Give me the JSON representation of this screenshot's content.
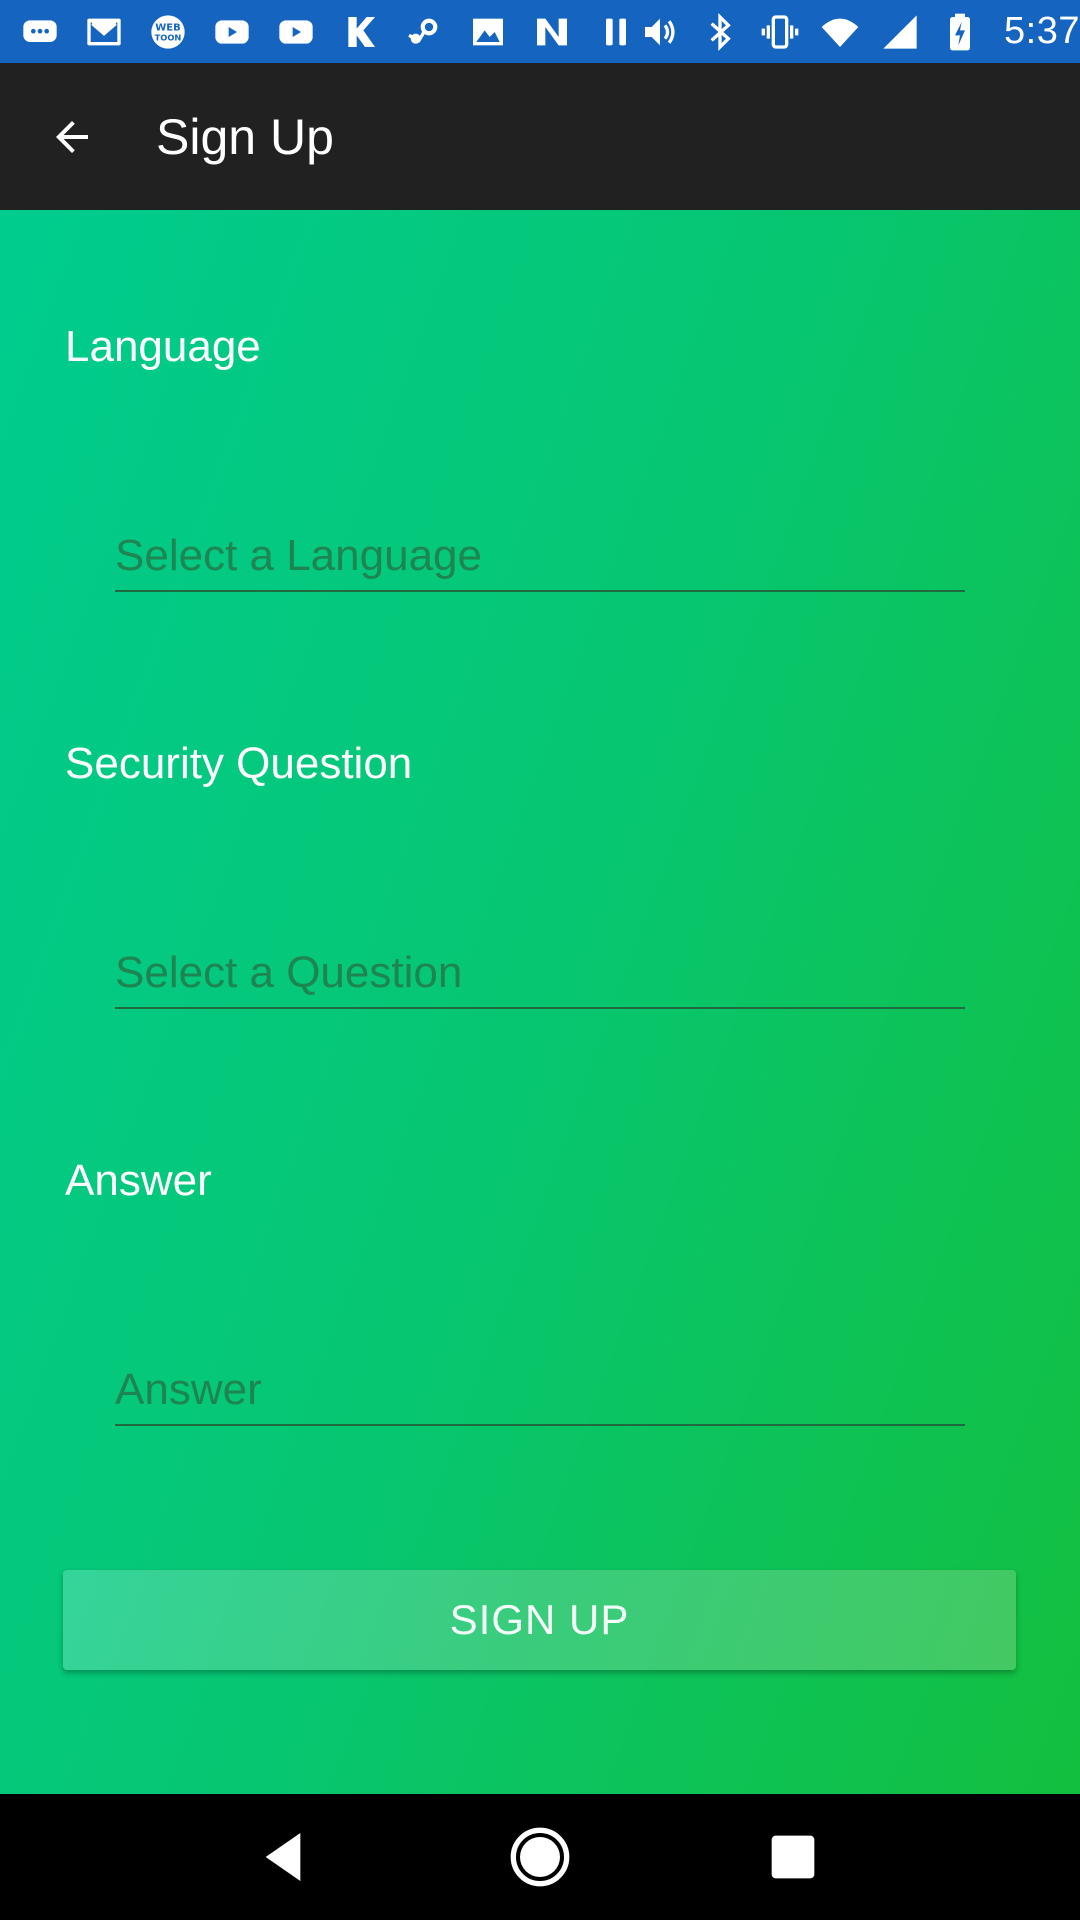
{
  "status_bar": {
    "time": "5:37",
    "left_icons": [
      "chat-icon",
      "gmail-icon",
      "webtoon-icon",
      "youtube-icon",
      "youtube-icon",
      "k-icon",
      "steam-icon",
      "image-icon",
      "n-icon",
      "pause-icon"
    ],
    "right_icons": [
      "volume-icon",
      "bluetooth-icon",
      "vibrate-icon",
      "wifi-icon",
      "signal-icon",
      "battery-charging-icon"
    ],
    "background": "#1565c0"
  },
  "app_bar": {
    "title": "Sign Up",
    "background": "#212121"
  },
  "form": {
    "language": {
      "label": "Language",
      "placeholder": "Select a Language",
      "value": ""
    },
    "security_question": {
      "label": "Security Question",
      "placeholder": "Select a Question",
      "value": ""
    },
    "answer": {
      "label": "Answer",
      "placeholder": "Answer",
      "value": ""
    },
    "submit_label": "SIGN UP"
  },
  "colors": {
    "gradient_start": "#00cc8f",
    "gradient_end": "#13bf3e",
    "underline": "#1f6a3f"
  }
}
